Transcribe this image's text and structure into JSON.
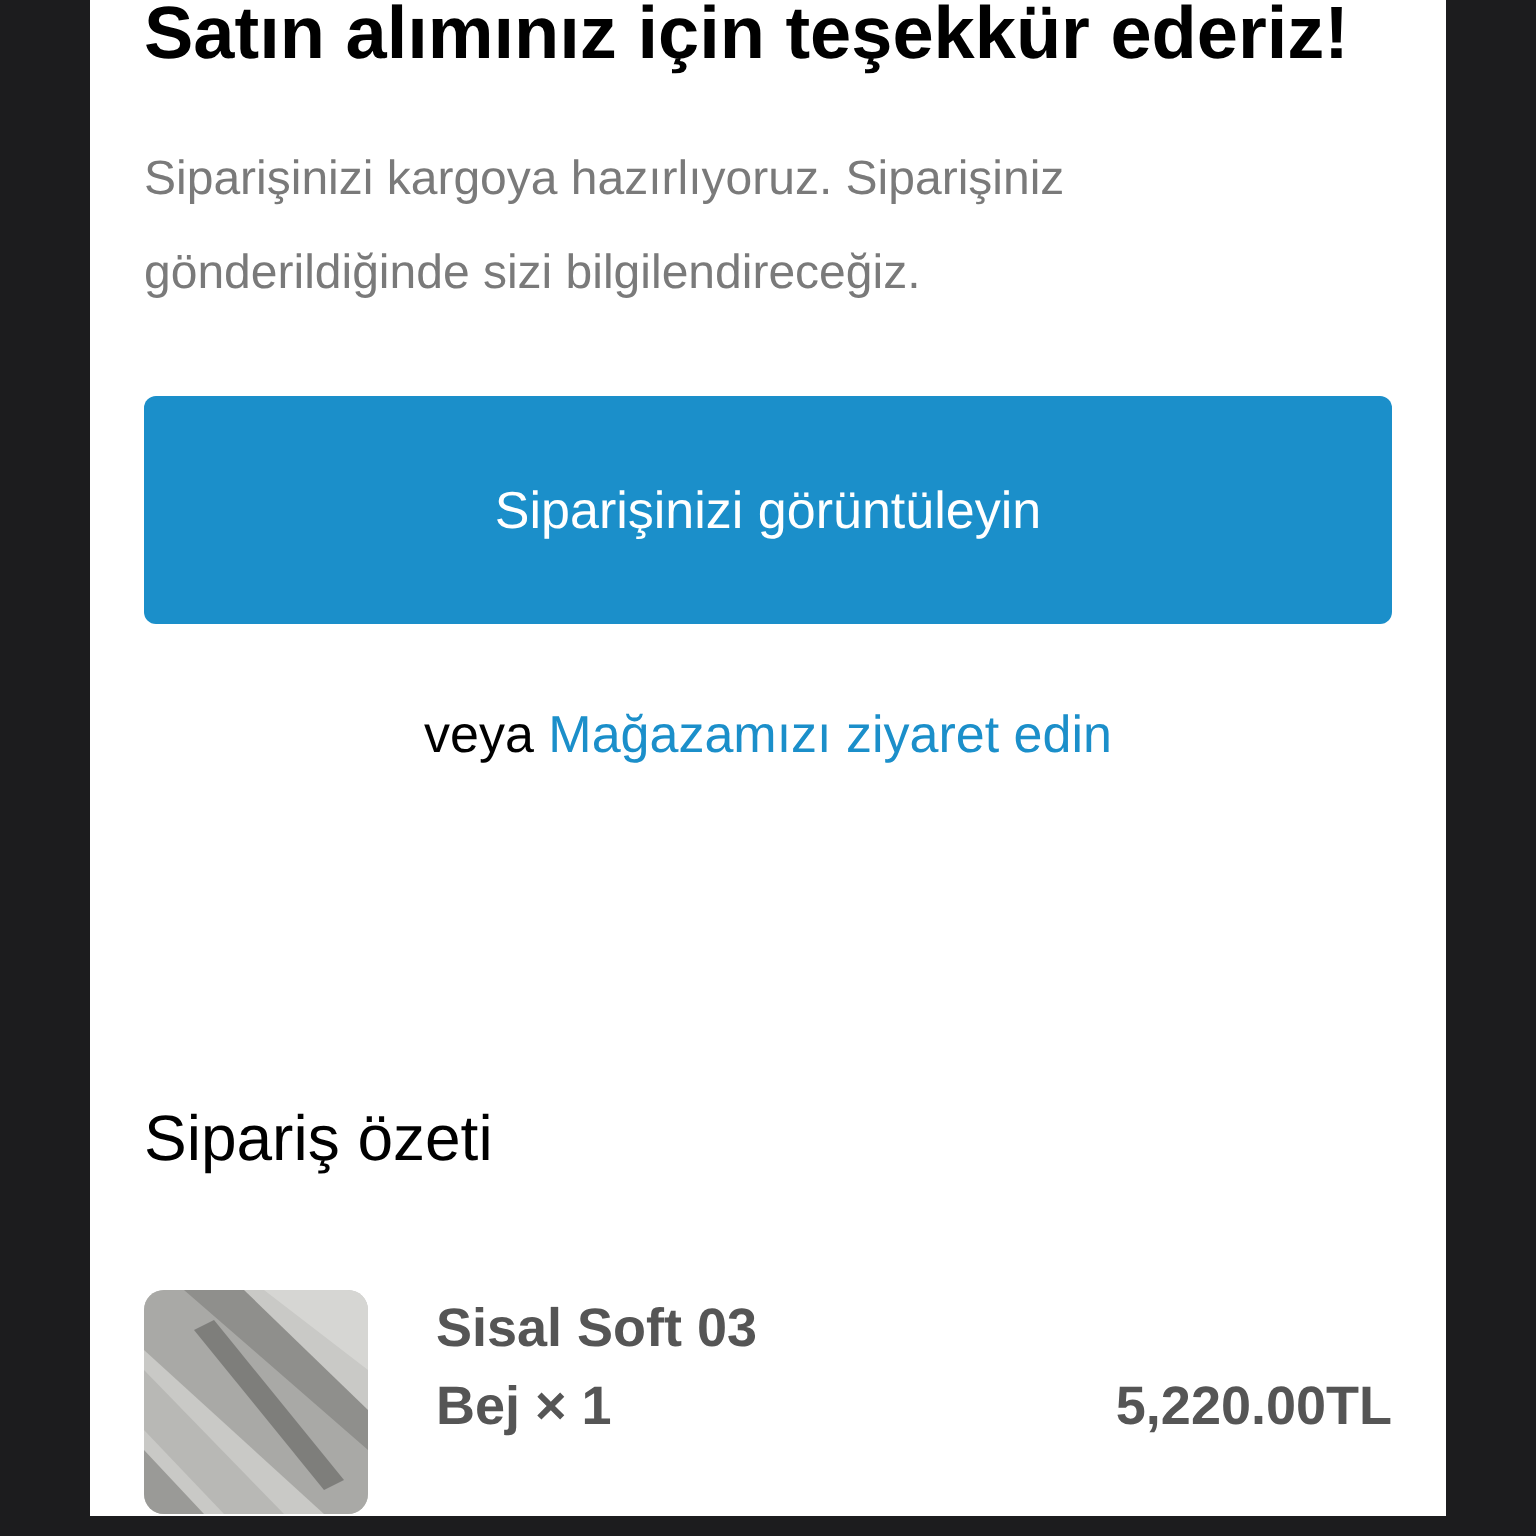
{
  "title": "Satın alımınız için teşekkür ederiz!",
  "message": "Siparişinizi kargoya hazırlıyoruz. Siparişiniz gönderildiğinde sizi bilgilendireceğiz.",
  "primary_button": "Siparişinizi görüntüleyin",
  "alternative": {
    "prefix": "veya",
    "link": "Mağazamızı ziyaret edin"
  },
  "summary": {
    "heading": "Sipariş özeti",
    "items": [
      {
        "kind": "picture",
        "name": "Sisal Soft 03",
        "variant": "Bej × 1",
        "price": "5,220.00TL"
      }
    ]
  }
}
